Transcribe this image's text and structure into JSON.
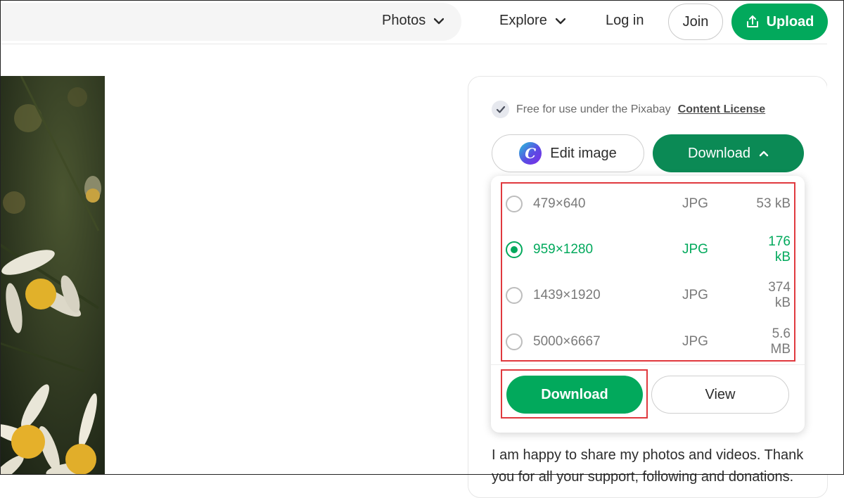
{
  "header": {
    "photos_label": "Photos",
    "explore_label": "Explore",
    "login_label": "Log in",
    "join_label": "Join",
    "upload_label": "Upload"
  },
  "panel": {
    "license_text": "Free for use under the Pixabay",
    "license_link": "Content License",
    "edit_image_label": "Edit image",
    "download_toggle_label": "Download",
    "options": [
      {
        "resolution": "479×640",
        "format": "JPG",
        "size": "53 kB",
        "selected": false
      },
      {
        "resolution": "959×1280",
        "format": "JPG",
        "size": "176 kB",
        "selected": true
      },
      {
        "resolution": "1439×1920",
        "format": "JPG",
        "size": "374 kB",
        "selected": false
      },
      {
        "resolution": "5000×6667",
        "format": "JPG",
        "size": "5.6 MB",
        "selected": false
      }
    ],
    "download_button_label": "Download",
    "view_button_label": "View",
    "description": "I am happy to share my photos and videos. Thank you for all your support, following and donations."
  },
  "colors": {
    "accent_green": "#02a95c",
    "dark_green": "#0b8a55",
    "highlight_red": "#e0393e"
  }
}
